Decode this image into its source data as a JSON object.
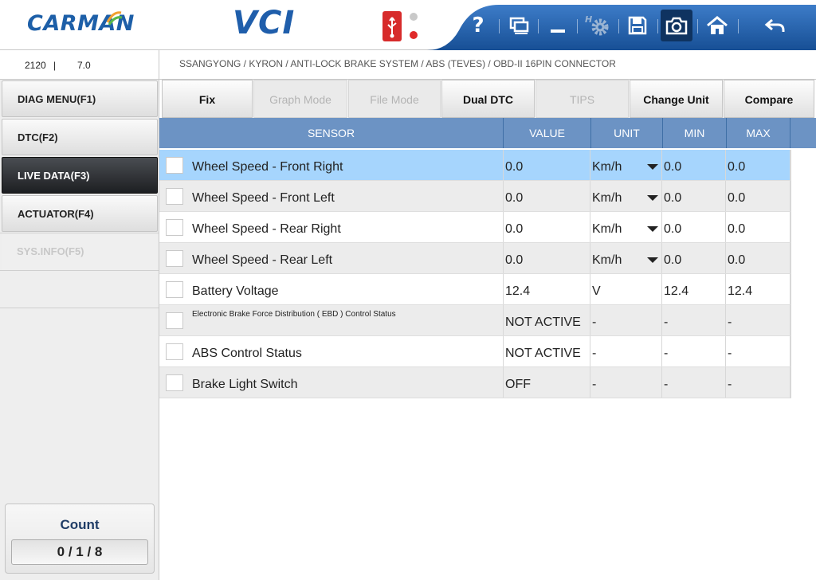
{
  "header": {
    "logo_text": "CARMAN",
    "product": "VCI",
    "toolbar": [
      {
        "name": "help-button",
        "icon": "question-mark-icon",
        "label": "?"
      },
      {
        "name": "screen-button",
        "icon": "monitor-icon"
      },
      {
        "name": "minimize-button",
        "icon": "minimize-icon"
      },
      {
        "name": "settings-button",
        "icon": "gear-icon"
      },
      {
        "name": "save-button",
        "icon": "floppy-disk-icon"
      },
      {
        "name": "capture-button",
        "icon": "camera-icon"
      },
      {
        "name": "home-button",
        "icon": "home-icon"
      },
      {
        "name": "back-button",
        "icon": "back-arrow-icon"
      }
    ],
    "colors": {
      "toolbar": "#1f5ea8",
      "logo": "#1d5fa8",
      "usb": "#d72b2b"
    }
  },
  "info": {
    "code": "2120",
    "separator": "|",
    "version": "7.0",
    "breadcrumb": "SSANGYONG / KYRON / ANTI-LOCK BRAKE SYSTEM / ABS (TEVES) / OBD-II 16PIN CONNECTOR"
  },
  "sidebar": {
    "items": [
      {
        "label": "DIAG MENU(F1)",
        "state": "normal"
      },
      {
        "label": "DTC(F2)",
        "state": "normal"
      },
      {
        "label": "LIVE DATA(F3)",
        "state": "active"
      },
      {
        "label": "ACTUATOR(F4)",
        "state": "normal"
      },
      {
        "label": "SYS.INFO(F5)",
        "state": "disabled"
      }
    ],
    "count_label": "Count",
    "count_value": "0 / 1 / 8"
  },
  "functions": [
    {
      "label": "Fix",
      "enabled": true
    },
    {
      "label": "Graph Mode",
      "enabled": false
    },
    {
      "label": "File Mode",
      "enabled": false
    },
    {
      "label": "Dual DTC",
      "enabled": true
    },
    {
      "label": "TIPS",
      "enabled": false
    },
    {
      "label": "Change Unit",
      "enabled": true
    },
    {
      "label": "Compare",
      "enabled": true
    }
  ],
  "table": {
    "columns": [
      "SENSOR",
      "VALUE",
      "UNIT",
      "MIN",
      "MAX"
    ],
    "rows": [
      {
        "sensor": "Wheel Speed - Front Right",
        "value": "0.0",
        "unit": "Km/h",
        "min": "0.0",
        "max": "0.0",
        "selected": true,
        "dropdown": true
      },
      {
        "sensor": "Wheel Speed - Front Left",
        "value": "0.0",
        "unit": "Km/h",
        "min": "0.0",
        "max": "0.0",
        "dropdown": true
      },
      {
        "sensor": "Wheel Speed - Rear Right",
        "value": "0.0",
        "unit": "Km/h",
        "min": "0.0",
        "max": "0.0",
        "dropdown": true
      },
      {
        "sensor": "Wheel Speed - Rear Left",
        "value": "0.0",
        "unit": "Km/h",
        "min": "0.0",
        "max": "0.0",
        "dropdown": true
      },
      {
        "sensor": "Battery Voltage",
        "value": "12.4",
        "unit": "V",
        "min": "12.4",
        "max": "12.4"
      },
      {
        "sensor": "Electronic Brake Force Distribution ( EBD ) Control Status",
        "value": "NOT ACTIVE",
        "unit": "-",
        "min": "-",
        "max": "-",
        "small": true
      },
      {
        "sensor": "ABS Control Status",
        "value": "NOT ACTIVE",
        "unit": "-",
        "min": "-",
        "max": "-"
      },
      {
        "sensor": "Brake Light Switch",
        "value": "OFF",
        "unit": "-",
        "min": "-",
        "max": "-"
      }
    ]
  }
}
